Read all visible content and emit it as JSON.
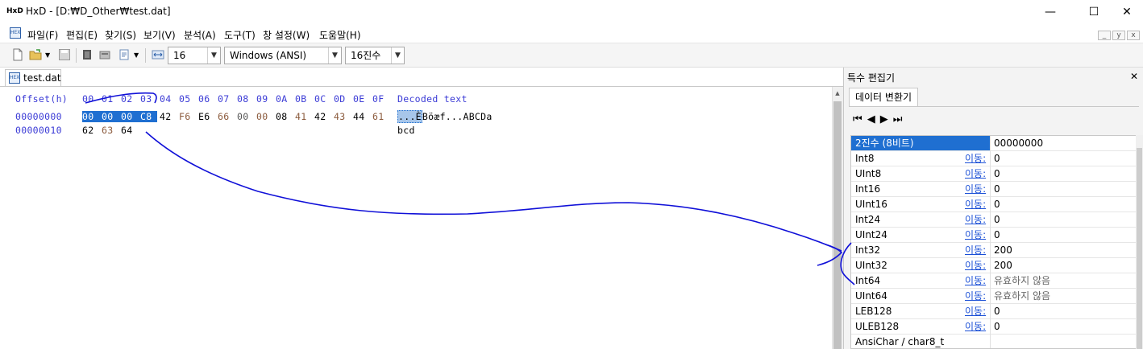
{
  "window": {
    "app_icon_text": "HxD",
    "title": "HxD - [D:₩D_Other₩test.dat]",
    "minimize_glyph": "—",
    "maximize_glyph": "☐",
    "close_glyph": "✕"
  },
  "menu": {
    "items": [
      "파일(F)",
      "편집(E)",
      "찾기(S)",
      "보기(V)",
      "분석(A)",
      "도구(T)",
      "창 설정(W)",
      "도움말(H)"
    ],
    "mdi_minimize": "_",
    "mdi_restore": "у",
    "mdi_close": "x"
  },
  "toolbar": {
    "bytes_per_row": "16",
    "charset": "Windows (ANSI)",
    "offset_base": "16진수"
  },
  "document_tab": {
    "label": "test.dat"
  },
  "hexview": {
    "offset_header": "Offset(h)",
    "column_headers": [
      "00",
      "01",
      "02",
      "03",
      "04",
      "05",
      "06",
      "07",
      "08",
      "09",
      "0A",
      "0B",
      "0C",
      "0D",
      "0E",
      "0F"
    ],
    "decoded_header": "Decoded text",
    "rows": [
      {
        "offset": "00000000",
        "bytes": [
          "00",
          "00",
          "00",
          "C8",
          "42",
          "F6",
          "E6",
          "66",
          "00",
          "00",
          "08",
          "41",
          "42",
          "43",
          "44",
          "61"
        ],
        "decoded_selected": "...È",
        "decoded_rest": "Böæf...ABCDa"
      },
      {
        "offset": "00000010",
        "bytes": [
          "62",
          "63",
          "64"
        ],
        "decoded_selected": "",
        "decoded_rest": "bcd"
      }
    ],
    "selected_byte_count": 4
  },
  "special_editor": {
    "title": "특수 편집기",
    "close_glyph": "✕",
    "tab_label": "데이터 변환기",
    "nav": [
      "⏮",
      "◀",
      "▶",
      "⏭"
    ],
    "link_label": "이동:",
    "rows": [
      {
        "name": "2진수 (8비트)",
        "link": "",
        "value": "00000000",
        "selected": true
      },
      {
        "name": "Int8",
        "link": "이동:",
        "value": "0"
      },
      {
        "name": "UInt8",
        "link": "이동:",
        "value": "0"
      },
      {
        "name": "Int16",
        "link": "이동:",
        "value": "0"
      },
      {
        "name": "UInt16",
        "link": "이동:",
        "value": "0"
      },
      {
        "name": "Int24",
        "link": "이동:",
        "value": "0"
      },
      {
        "name": "UInt24",
        "link": "이동:",
        "value": "0"
      },
      {
        "name": "Int32",
        "link": "이동:",
        "value": "200"
      },
      {
        "name": "UInt32",
        "link": "이동:",
        "value": "200"
      },
      {
        "name": "Int64",
        "link": "이동:",
        "value": "유효하지 않음",
        "invalid": true
      },
      {
        "name": "UInt64",
        "link": "이동:",
        "value": "유효하지 않음",
        "invalid": true
      },
      {
        "name": "LEB128",
        "link": "이동:",
        "value": "0"
      },
      {
        "name": "ULEB128",
        "link": "이동:",
        "value": "0"
      },
      {
        "name": "AnsiChar / char8_t",
        "link": "",
        "value": ""
      }
    ]
  },
  "colors": {
    "selection": "#1f6fd1",
    "header_blue": "#3b3bd6",
    "annotation": "#1010d8"
  }
}
